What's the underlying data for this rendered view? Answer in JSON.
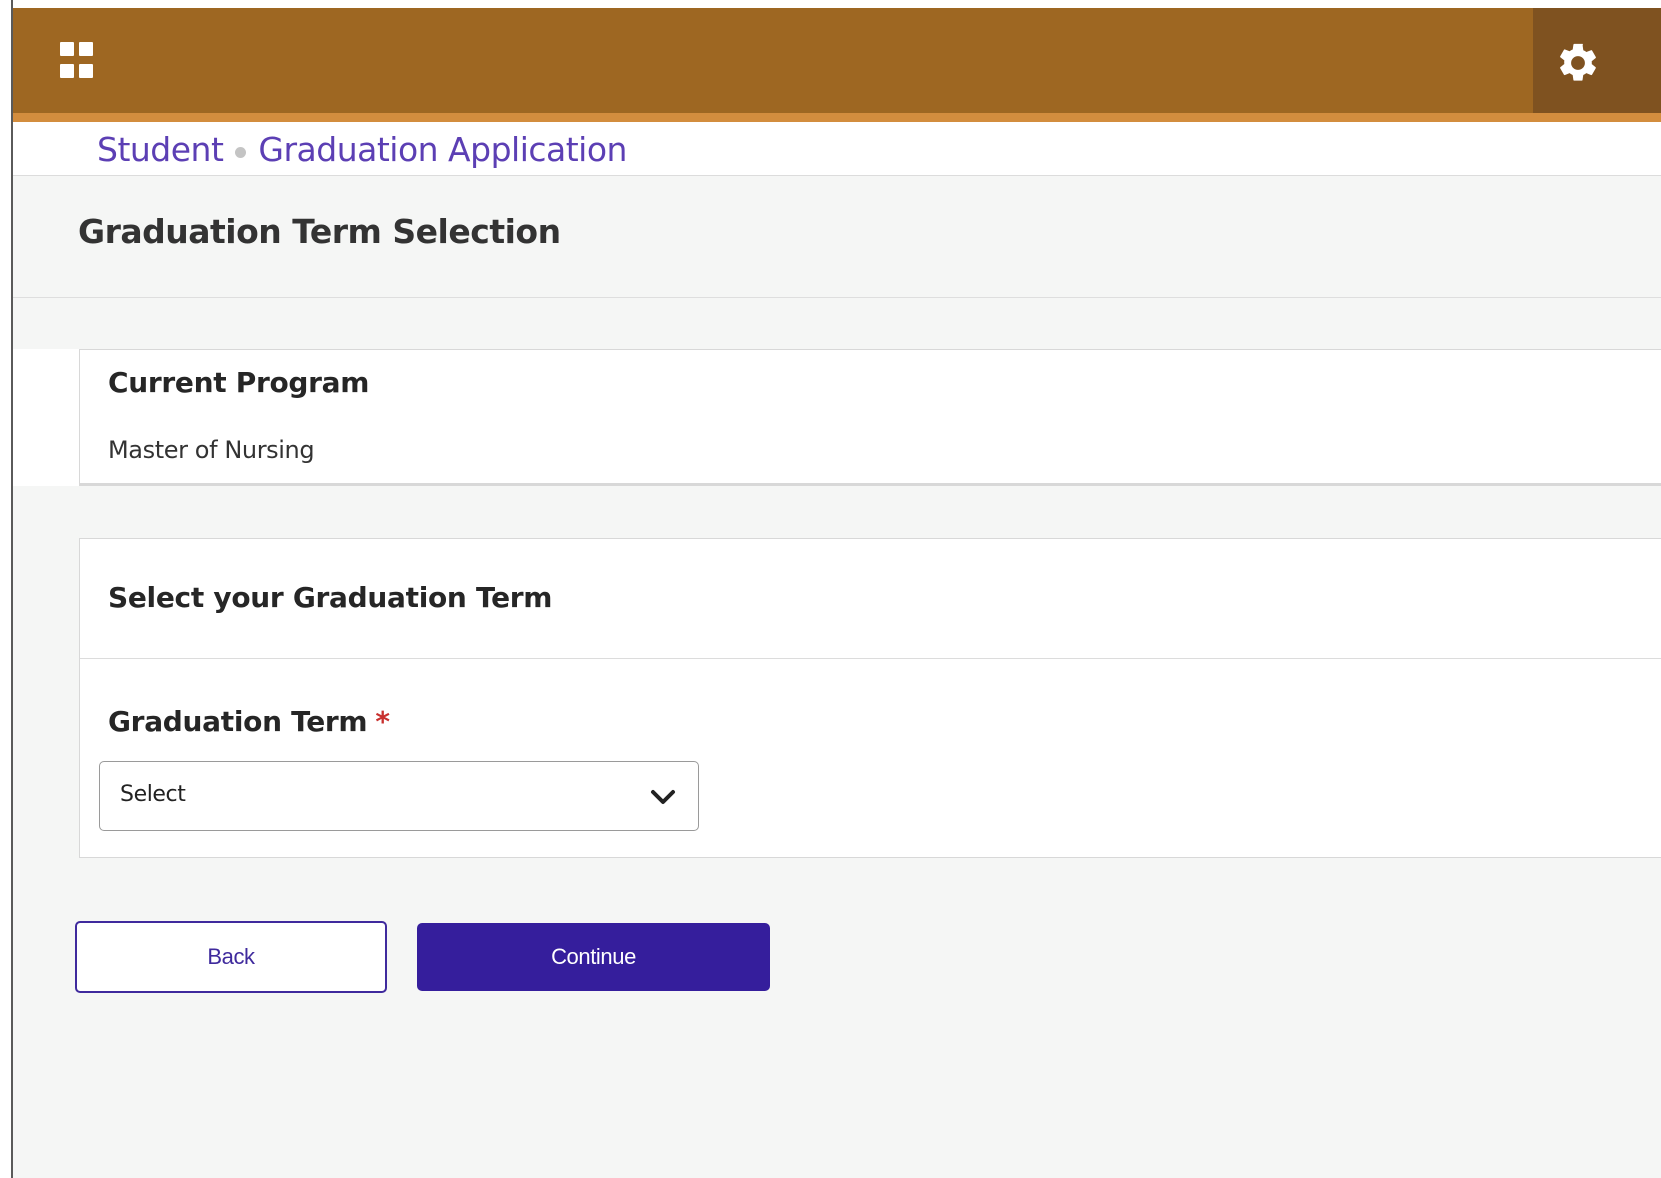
{
  "header": {
    "menu_icon": "grid-menu-icon",
    "settings_icon": "gear-icon",
    "colors": {
      "bar": "#9e6722",
      "bar_accent": "#d38d3e",
      "settings_bg": "#7f5220"
    }
  },
  "breadcrumb": {
    "items": [
      "Student",
      "Graduation Application"
    ]
  },
  "page": {
    "title": "Graduation Term Selection"
  },
  "current_program": {
    "heading": "Current Program",
    "value": "Master of Nursing"
  },
  "term_section": {
    "heading": "Select your Graduation Term",
    "field_label": "Graduation Term",
    "required_marker": "*",
    "select_value": "Select",
    "select_icon": "chevron-down-icon"
  },
  "actions": {
    "back_label": "Back",
    "continue_label": "Continue",
    "primary_color": "#351e9c"
  }
}
